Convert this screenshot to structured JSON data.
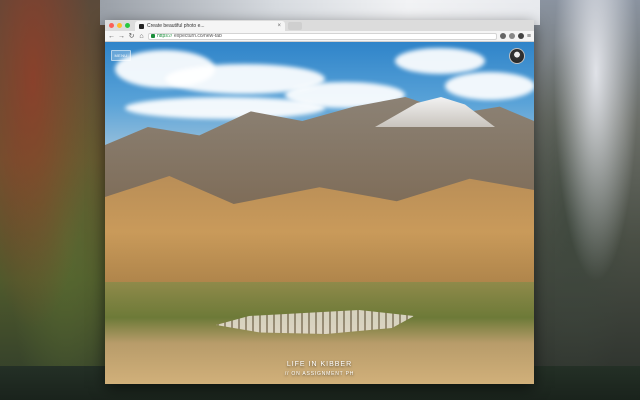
{
  "browser": {
    "tab_title": "Create beautiful photo e...",
    "url_scheme": "https://",
    "url_rest": "expecturn.co/new-tab"
  },
  "page": {
    "menu_label": "MENU",
    "photo_title": "LIFE IN KIBBER",
    "photo_credit": "// ON ASSIGNMENT PH"
  },
  "icons": [
    "close-icon",
    "back-icon",
    "forward-icon",
    "reload-icon",
    "home-icon",
    "lock-icon",
    "extension-icon",
    "menu-icon",
    "avatar"
  ]
}
